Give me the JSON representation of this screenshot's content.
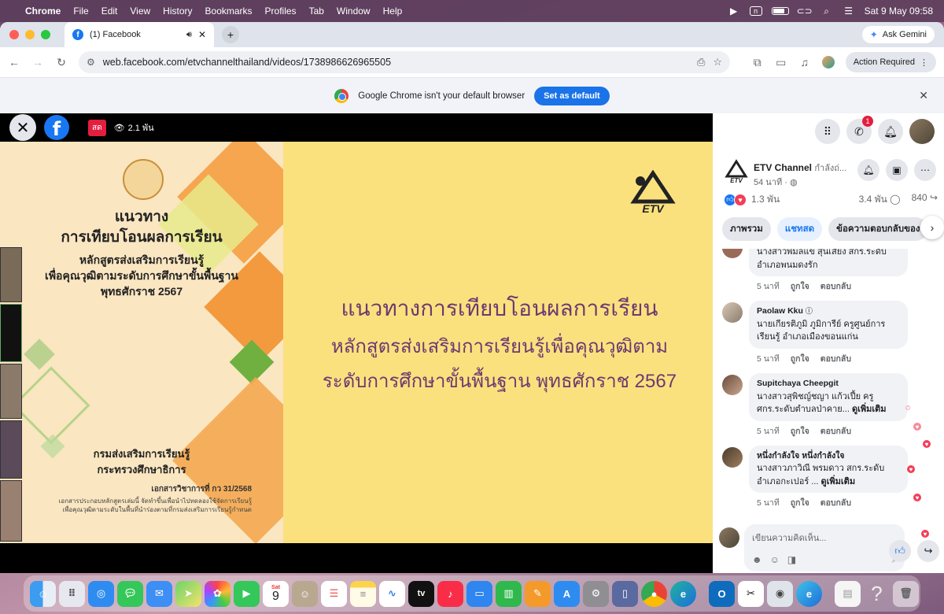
{
  "menubar": {
    "app": "Chrome",
    "items": [
      "File",
      "Edit",
      "View",
      "History",
      "Bookmarks",
      "Profiles",
      "Tab",
      "Window",
      "Help"
    ],
    "clock": "Sat 9 May  09:58"
  },
  "browser": {
    "tab_title": "(1) Facebook",
    "gemini_label": "Ask Gemini",
    "url": "web.facebook.com/etvchannelthailand/videos/1738986626965505",
    "action_required": "Action Required",
    "infobar_text": "Google Chrome isn't your default browser",
    "set_default_label": "Set as default"
  },
  "video": {
    "live_label": "สด",
    "viewers": "2.1 พัน",
    "slide": {
      "left_title_1": "แนวทาง",
      "left_title_2": "การเทียบโอนผลการเรียน",
      "left_sub_1": "หลักสูตรส่งเสริมการเรียนรู้",
      "left_sub_2": "เพื่อคุณวุฒิตามระดับการศึกษาขั้นพื้นฐาน",
      "left_sub_3": "พุทธศักราช 2567",
      "left_dept_1": "กรมส่งเสริมการเรียนรู้",
      "left_dept_2": "กระทรวงศึกษาธิการ",
      "left_doc": "เอกสารวิชาการที่ กว 31/2568",
      "left_desc_1": "เอกสารประกอบหลักสูตรเล่มนี้ จัดทำขึ้นเพื่อนำไปทดลองใช้จัดการเรียนรู้",
      "left_desc_2": "เพื่อคุณวุฒิตามระดับในพื้นที่นำร่องตามที่กรมส่งเสริมการเรียนรู้กำหนด",
      "main_1": "แนวทางการเทียบโอนผลการเรียน",
      "main_2": "หลักสูตรส่งเสริมการเรียนรู้เพื่อคุณวุฒิตาม",
      "main_3": "ระดับการศึกษาขั้นพื้นฐาน พุทธศักราช 2567",
      "logo_text": "ETV"
    }
  },
  "panel": {
    "messenger_badge": "1",
    "channel_name": "ETV Channel",
    "channel_status": "กำลังถ่...",
    "channel_time": "54 นาที · ",
    "reactions_count": "1.3 พัน",
    "comments_count": "3.4 พัน",
    "shares_count": "840",
    "tabs": [
      "ภาพรวม",
      "แชทสด",
      "ข้อความตอบกลับของ"
    ],
    "comments": [
      {
        "name": "",
        "text": "นางสาวพิมลแข สุนเสียง สกร.ระดับอำเภอพนมดงรัก",
        "time": "5 นาที",
        "like": "ถูกใจ",
        "reply": "ตอบกลับ",
        "more": ""
      },
      {
        "name": "Paolaw Kku",
        "text": "นายเกียรติภูมิ ภูมิการีย์ ครูศูนย์การเรียนรู้ อำเภอเมืองขอนแก่น",
        "time": "5 นาที",
        "like": "ถูกใจ",
        "reply": "ตอบกลับ",
        "more": ""
      },
      {
        "name": "Supitchaya Cheepgit",
        "text": "นางสาวสุพิชญ์ชญา แก้วเปี้ย ครูศกร.ระดับตำบลป่าคาย...",
        "time": "5 นาที",
        "like": "ถูกใจ",
        "reply": "ตอบกลับ",
        "more": "ดูเพิ่มเติม"
      },
      {
        "name": "หนึ่งกำลังใจ หนึ่งกำลังใจ",
        "text": "นางสาวภาวิณี พรมดาว สกร.ระดับอำเภอกะเปอร์ ...",
        "time": "5 นาที",
        "like": "ถูกใจ",
        "reply": "ตอบกลับ",
        "more": "ดูเพิ่มเติม"
      }
    ],
    "compose_placeholder": "เขียนความคิดเห็น..."
  },
  "dock": {
    "calendar_day": "9",
    "calendar_month": "Sat",
    "tv_label": "tv"
  },
  "colors": {
    "facebook_blue": "#1877f2",
    "live_red": "#e41e3f",
    "slide_yellow": "#fbe17e",
    "slide_text_purple": "#6a3b70"
  }
}
